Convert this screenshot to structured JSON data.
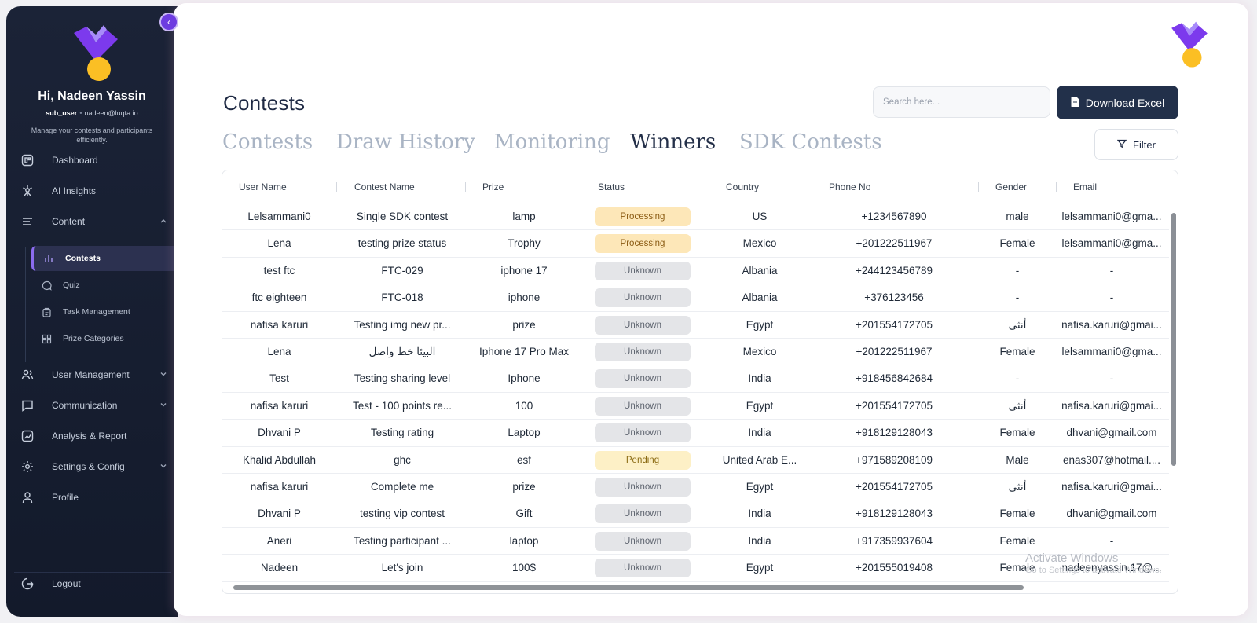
{
  "sidebar": {
    "greeting": "Hi, Nadeen Yassin",
    "role": "sub_user",
    "email": "nadeen@luqta.io",
    "tagline": "Manage your contests and participants efficiently.",
    "items": [
      {
        "label": "Dashboard",
        "icon": "dashboard-icon"
      },
      {
        "label": "AI Insights",
        "icon": "ai-insights-icon"
      },
      {
        "label": "Content",
        "icon": "content-icon"
      },
      {
        "label": "User Management",
        "icon": "users-icon"
      },
      {
        "label": "Communication",
        "icon": "chat-icon"
      },
      {
        "label": "Analysis & Report",
        "icon": "report-icon"
      },
      {
        "label": "Settings & Config",
        "icon": "gear-icon"
      },
      {
        "label": "Profile",
        "icon": "profile-icon"
      }
    ],
    "sub_items": [
      {
        "label": "Contests",
        "icon": "bar-chart-icon",
        "active": true
      },
      {
        "label": "Quiz",
        "icon": "quiz-icon"
      },
      {
        "label": "Task Management",
        "icon": "clipboard-icon"
      },
      {
        "label": "Prize Categories",
        "icon": "grid-icon"
      }
    ],
    "logout": "Logout"
  },
  "header": {
    "title": "Contests",
    "search_placeholder": "Search here...",
    "download_label": "Download Excel",
    "filter_label": "Filter"
  },
  "tabs": [
    {
      "label": "Contests"
    },
    {
      "label": "Draw History"
    },
    {
      "label": "Monitoring"
    },
    {
      "label": "Winners",
      "active": true
    },
    {
      "label": "SDK Contests"
    }
  ],
  "table": {
    "columns": [
      "User Name",
      "Contest Name",
      "Prize",
      "Status",
      "Country",
      "Phone No",
      "Gender",
      "Email"
    ],
    "rows": [
      {
        "user": "Lelsammani0",
        "contest": "Single SDK contest",
        "prize": "lamp",
        "status": "Processing",
        "country": "US",
        "phone": "+1234567890",
        "gender": "male",
        "email": "lelsammani0@gma..."
      },
      {
        "user": "Lena",
        "contest": "testing prize status",
        "prize": "Trophy",
        "status": "Processing",
        "country": "Mexico",
        "phone": "+201222511967",
        "gender": "Female",
        "email": "lelsammani0@gma..."
      },
      {
        "user": "test ftc",
        "contest": "FTC-029",
        "prize": "iphone 17",
        "status": "Unknown",
        "country": "Albania",
        "phone": "+244123456789",
        "gender": "-",
        "email": "-"
      },
      {
        "user": "ftc eighteen",
        "contest": "FTC-018",
        "prize": "iphone",
        "status": "Unknown",
        "country": "Albania",
        "phone": "+376123456",
        "gender": "-",
        "email": "-"
      },
      {
        "user": "nafisa karuri",
        "contest": "Testing img new pr...",
        "prize": "prize",
        "status": "Unknown",
        "country": "Egypt",
        "phone": "+201554172705",
        "gender": "أنثى",
        "email": "nafisa.karuri@gmai..."
      },
      {
        "user": "Lena",
        "contest": "البيئا خط واصل",
        "prize": "Iphone 17 Pro Max",
        "status": "Unknown",
        "country": "Mexico",
        "phone": "+201222511967",
        "gender": "Female",
        "email": "lelsammani0@gma..."
      },
      {
        "user": "Test",
        "contest": "Testing sharing level",
        "prize": "Iphone",
        "status": "Unknown",
        "country": "India",
        "phone": "+918456842684",
        "gender": "-",
        "email": "-"
      },
      {
        "user": "nafisa karuri",
        "contest": "Test - 100 points re...",
        "prize": "100",
        "status": "Unknown",
        "country": "Egypt",
        "phone": "+201554172705",
        "gender": "أنثى",
        "email": "nafisa.karuri@gmai..."
      },
      {
        "user": "Dhvani P",
        "contest": "Testing rating",
        "prize": "Laptop",
        "status": "Unknown",
        "country": "India",
        "phone": "+918129128043",
        "gender": "Female",
        "email": "dhvani@gmail.com"
      },
      {
        "user": "Khalid Abdullah",
        "contest": "ghc",
        "prize": "esf",
        "status": "Pending",
        "country": "United Arab E...",
        "phone": "+971589208109",
        "gender": "Male",
        "email": "enas307@hotmail...."
      },
      {
        "user": "nafisa karuri",
        "contest": "Complete me",
        "prize": "prize",
        "status": "Unknown",
        "country": "Egypt",
        "phone": "+201554172705",
        "gender": "أنثى",
        "email": "nafisa.karuri@gmai..."
      },
      {
        "user": "Dhvani P",
        "contest": "testing vip contest",
        "prize": "Gift",
        "status": "Unknown",
        "country": "India",
        "phone": "+918129128043",
        "gender": "Female",
        "email": "dhvani@gmail.com"
      },
      {
        "user": "Aneri",
        "contest": "Testing participant ...",
        "prize": "laptop",
        "status": "Unknown",
        "country": "India",
        "phone": "+917359937604",
        "gender": "Female",
        "email": "-"
      },
      {
        "user": "Nadeen",
        "contest": "Let's join",
        "prize": "100$",
        "status": "Unknown",
        "country": "Egypt",
        "phone": "+201555019408",
        "gender": "Female",
        "email": "nadeenyassin.17@..."
      }
    ]
  },
  "watermark": {
    "line1": "Activate Windows",
    "line2": "Go to Settings to activate Windows."
  },
  "colors": {
    "accent": "#6d3ce0",
    "logo_purple": "#7c3aed",
    "logo_yellow": "#fbbf24",
    "primary_button": "#22304a"
  }
}
